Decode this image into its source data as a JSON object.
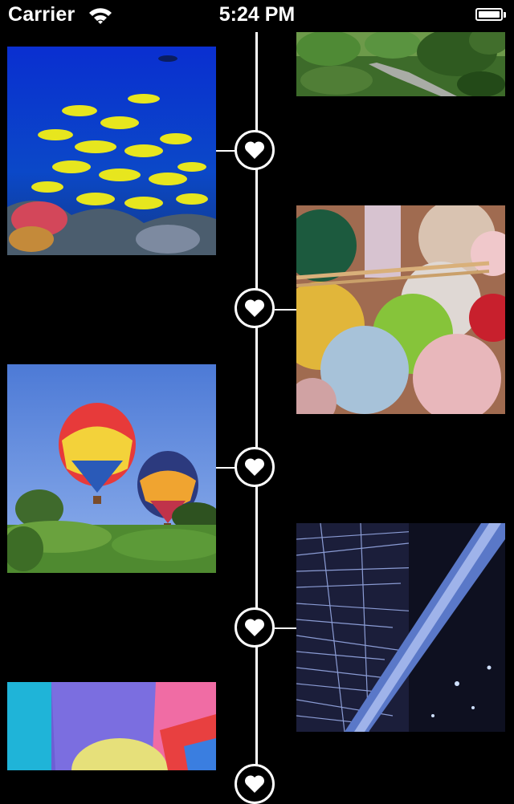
{
  "status_bar": {
    "carrier": "Carrier",
    "time": "5:24 PM",
    "wifi_icon": "wifi-icon",
    "battery_icon": "battery-icon"
  },
  "timeline": {
    "line_color": "#ffffff",
    "node_icon": "heart-icon",
    "items": [
      {
        "image": "road-green-trees-photo",
        "side": "right"
      },
      {
        "image": "coral-reef-fish-photo",
        "side": "left"
      },
      {
        "image": "yarn-balls-photo",
        "side": "right"
      },
      {
        "image": "hot-air-balloons-photo",
        "side": "left"
      },
      {
        "image": "fiber-optic-lights-photo",
        "side": "right"
      },
      {
        "image": "colorful-balloon-photo",
        "side": "left"
      }
    ]
  }
}
